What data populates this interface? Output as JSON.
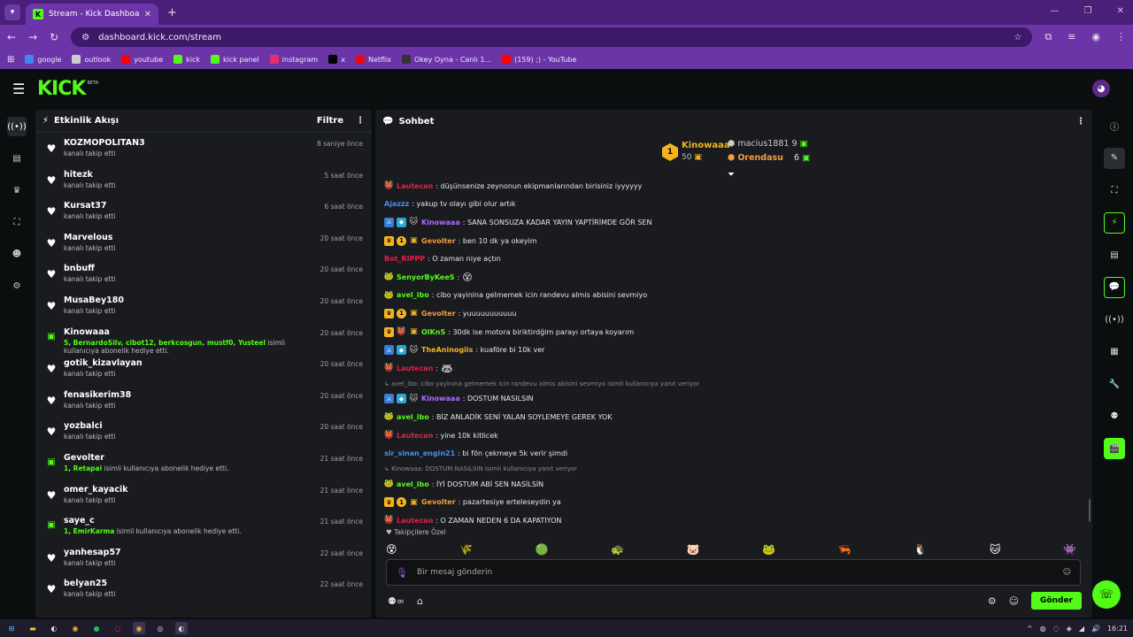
{
  "browser": {
    "tab_title": "Stream - Kick Dashboard",
    "address": "dashboard.kick.com/stream",
    "bookmarks": [
      {
        "label": "google",
        "icon": "google-icon",
        "color": "#4285f4"
      },
      {
        "label": "outlook",
        "icon": "outlook-icon",
        "color": "#cccccc"
      },
      {
        "label": "youtube",
        "icon": "youtube-icon",
        "color": "#ff0000"
      },
      {
        "label": "kick",
        "icon": "kick-icon",
        "color": "#53fc18"
      },
      {
        "label": "kick panel",
        "icon": "kick-icon",
        "color": "#53fc18"
      },
      {
        "label": "instagram",
        "icon": "instagram-icon",
        "color": "#e1306c"
      },
      {
        "label": "x",
        "icon": "x-icon",
        "color": "#000000"
      },
      {
        "label": "Netflix",
        "icon": "netflix-icon",
        "color": "#e50914"
      },
      {
        "label": "Okey Oyna - Canlı 1...",
        "icon": "okey-icon",
        "color": "#333333"
      },
      {
        "label": "(159) ;) - YouTube",
        "icon": "youtube-icon",
        "color": "#ff0000"
      }
    ]
  },
  "header": {
    "logo": "KICK",
    "beta": "BETA"
  },
  "activity": {
    "title": "Etkinlik Akışı",
    "filter_label": "Filtre",
    "items": [
      {
        "name": "KOZMOPOLITAN3",
        "type": "follow",
        "desc": "kanalı takip etti",
        "time": "8 saniye önce"
      },
      {
        "name": "hitezk",
        "type": "follow",
        "desc": "kanalı takip etti",
        "time": "5 saat önce"
      },
      {
        "name": "Kursat37",
        "type": "follow",
        "desc": "kanalı takip etti",
        "time": "6 saat önce"
      },
      {
        "name": "Marvelous",
        "type": "follow",
        "desc": "kanalı takip etti",
        "time": "20 saat önce"
      },
      {
        "name": "bnbuff",
        "type": "follow",
        "desc": "kanalı takip etti",
        "time": "20 saat önce"
      },
      {
        "name": "MusaBey180",
        "type": "follow",
        "desc": "kanalı takip etti",
        "time": "20 saat önce"
      },
      {
        "name": "Kinowaaa",
        "type": "gift",
        "hl": "5, BernardoSilv, cibot12, berkcosgun, mustf0, Yusteel",
        "desc": " isimli kullanıcıya abonelik hediye etti.",
        "time": "20 saat önce"
      },
      {
        "name": "gotik_kizavlayan",
        "type": "follow",
        "desc": "kanalı takip etti",
        "time": "20 saat önce"
      },
      {
        "name": "fenasikerim38",
        "type": "follow",
        "desc": "kanalı takip etti",
        "time": "20 saat önce"
      },
      {
        "name": "yozbalci",
        "type": "follow",
        "desc": "kanalı takip etti",
        "time": "20 saat önce"
      },
      {
        "name": "Gevolter",
        "type": "gift",
        "hl": "1, Retapai",
        "desc": " isimli kullanıcıya abonelik hediye etti.",
        "time": "21 saat önce"
      },
      {
        "name": "omer_kayacik",
        "type": "follow",
        "desc": "kanalı takip etti",
        "time": "21 saat önce"
      },
      {
        "name": "saye_c",
        "type": "gift",
        "hl": "1, EmirKarma",
        "desc": " isimli kullanıcıya abonelik hediye etti.",
        "time": "21 saat önce"
      },
      {
        "name": "yanhesap57",
        "type": "follow",
        "desc": "kanalı takip etti",
        "time": "22 saat önce"
      },
      {
        "name": "belyan25",
        "type": "follow",
        "desc": "kanalı takip etti",
        "time": "22 saat önce"
      }
    ]
  },
  "chat": {
    "title": "Sohbet",
    "leaderboard": {
      "first_rank": "1",
      "first_name": "Kinowaaa",
      "first_count": "50",
      "second_name": "macius1881",
      "second_count": "9",
      "third_name": "Orendasu",
      "third_count": "6"
    },
    "messages": [
      {
        "badges": [
          "devil"
        ],
        "user": "Lautecan",
        "color": "#e0204a",
        "text": ": düşünsenize zeynonun ekipmanlarından birisiniz iyyyyyy"
      },
      {
        "badges": [],
        "user": "Ajazzz",
        "color": "#4a8fe8",
        "text": ": yakup tv olayı gibi olur artık"
      },
      {
        "badges": [
          "mod",
          "vip",
          "cat"
        ],
        "user": "Kinowaaa",
        "color": "#b06bff",
        "text": ": SANA SONSUZA KADAR YAYIN YAPTİRİMDE GÖR SEN"
      },
      {
        "badges": [
          "crown",
          "one",
          "gift"
        ],
        "user": "Gevolter",
        "color": "#f59c3d",
        "text": ": ben 10 dk ya okeyim"
      },
      {
        "badges": [],
        "user": "Bot_RIPPP",
        "color": "#e0204a",
        "text": ": O zaman niye açtın"
      },
      {
        "badges": [
          "frog"
        ],
        "user": "SenyorByKeeS",
        "color": "#53fc18",
        "text": ":",
        "emote": "😵"
      },
      {
        "badges": [
          "frog"
        ],
        "user": "avel_ibo",
        "color": "#53fc18",
        "text": ": cibo yayinina gelmemek icin randevu almis abisini sevmiyo"
      },
      {
        "badges": [
          "crown",
          "one",
          "gift"
        ],
        "user": "Gevolter",
        "color": "#f59c3d",
        "text": ": yuuuuuuuuuuu"
      },
      {
        "badges": [
          "crown",
          "devil",
          "gift"
        ],
        "user": "OlKnS",
        "color": "#53fc18",
        "text": ": 30dk ise motora biriktirdğim parayı ortaya koyarım"
      },
      {
        "badges": [
          "mod",
          "vip",
          "cat"
        ],
        "user": "TheAninogiis",
        "color": "#f5b41e",
        "text": ": kuaföre bi 10k ver"
      },
      {
        "badges": [
          "devil"
        ],
        "user": "Lautecan",
        "color": "#e0204a",
        "text": ":",
        "emote": "🦝"
      },
      {
        "reply": "↳ avel_ibo: cibo yayinina gelmemek icin randevu almis abisini sevmiyo isimli kullanıcıya yanıt veriyor"
      },
      {
        "badges": [
          "mod",
          "vip",
          "cat"
        ],
        "user": "Kinowaaa",
        "color": "#b06bff",
        "text": ": DOSTUM NASILSIN"
      },
      {
        "badges": [
          "frog"
        ],
        "user": "avel_ibo",
        "color": "#53fc18",
        "text": ": BİZ ANLADİK SENİ YALAN SOYLEMEYE GEREK YOK"
      },
      {
        "badges": [
          "devil"
        ],
        "user": "Lautecan",
        "color": "#e0204a",
        "text": ": yine 10k kitlicek"
      },
      {
        "badges": [],
        "user": "sir_sinan_engin21",
        "color": "#4a8fe8",
        "text": ": bi fön çekmeye 5k verir şimdi"
      },
      {
        "reply": "↳ Kinowaaa: DOSTUM NASILSIN isimli kullanıcıya yanıt veriyor"
      },
      {
        "badges": [
          "frog"
        ],
        "user": "avel_ibo",
        "color": "#53fc18",
        "text": ": İYİ DOSTUM ABİ SEN NASİLSİN"
      },
      {
        "badges": [
          "crown",
          "one",
          "gift"
        ],
        "user": "Gevolter",
        "color": "#f59c3d",
        "text": ": pazartesiye erteleseydin ya"
      },
      {
        "badges": [
          "devil"
        ],
        "user": "Lautecan",
        "color": "#e0204a",
        "text": ": O ZAMAN NEDEN 6 DA KAPATIYON"
      }
    ],
    "followers_only": "Takipçilere Özel",
    "input_placeholder": "Bir mesaj gönderin",
    "send_label": "Gönder"
  },
  "taskbar": {
    "time": "16:21"
  }
}
